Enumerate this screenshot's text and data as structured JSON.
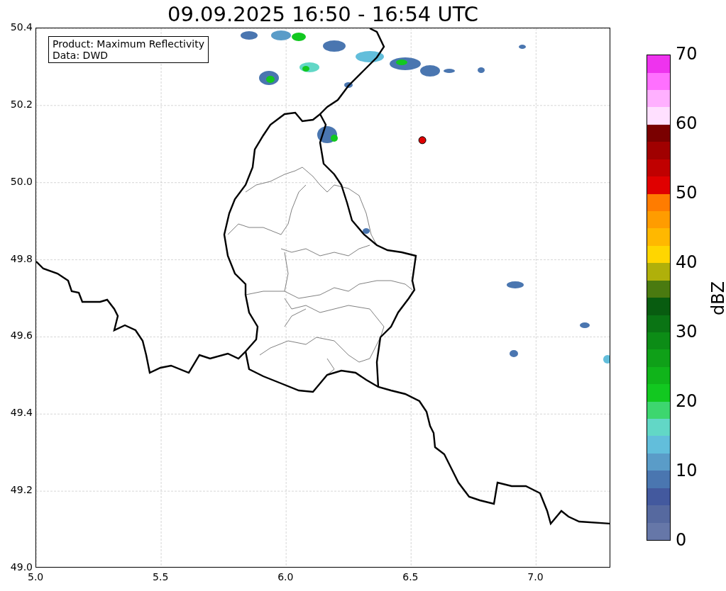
{
  "title": "09.09.2025 16:50 - 16:54 UTC",
  "info_box": {
    "lines": [
      "Product: Maximum Reflectivity",
      "Data: DWD"
    ]
  },
  "map": {
    "xticks": [
      "5.0",
      "5.5",
      "6.0",
      "6.5",
      "7.0"
    ],
    "yticks": [
      "50.4",
      "50.2",
      "50.0",
      "49.8",
      "49.6",
      "49.4",
      "49.2",
      "49.0"
    ]
  },
  "colorbar": {
    "label": "dBZ",
    "ticks": [
      "70",
      "60",
      "50",
      "40",
      "30",
      "20",
      "10",
      "0"
    ],
    "segments": [
      {
        "color": "#6677a8"
      },
      {
        "color": "#56699f"
      },
      {
        "color": "#43599e"
      },
      {
        "color": "#4a76b0"
      },
      {
        "color": "#5a9cc8"
      },
      {
        "color": "#62bedb"
      },
      {
        "color": "#62d7c6"
      },
      {
        "color": "#3dd66f"
      },
      {
        "color": "#12c820"
      },
      {
        "color": "#10b41a"
      },
      {
        "color": "#0fa018"
      },
      {
        "color": "#0c8c16"
      },
      {
        "color": "#0a7414"
      },
      {
        "color": "#085c10"
      },
      {
        "color": "#4a7a10"
      },
      {
        "color": "#b0b00a"
      },
      {
        "color": "#ffd600"
      },
      {
        "color": "#ffb800"
      },
      {
        "color": "#ff9c00"
      },
      {
        "color": "#ff7c00"
      },
      {
        "color": "#e00000"
      },
      {
        "color": "#c00000"
      },
      {
        "color": "#a00000"
      },
      {
        "color": "#7a0000"
      },
      {
        "color": "#ffe0ff"
      },
      {
        "color": "#ffb0ff"
      },
      {
        "color": "#ff70ff"
      },
      {
        "color": "#ee33ee"
      }
    ]
  }
}
